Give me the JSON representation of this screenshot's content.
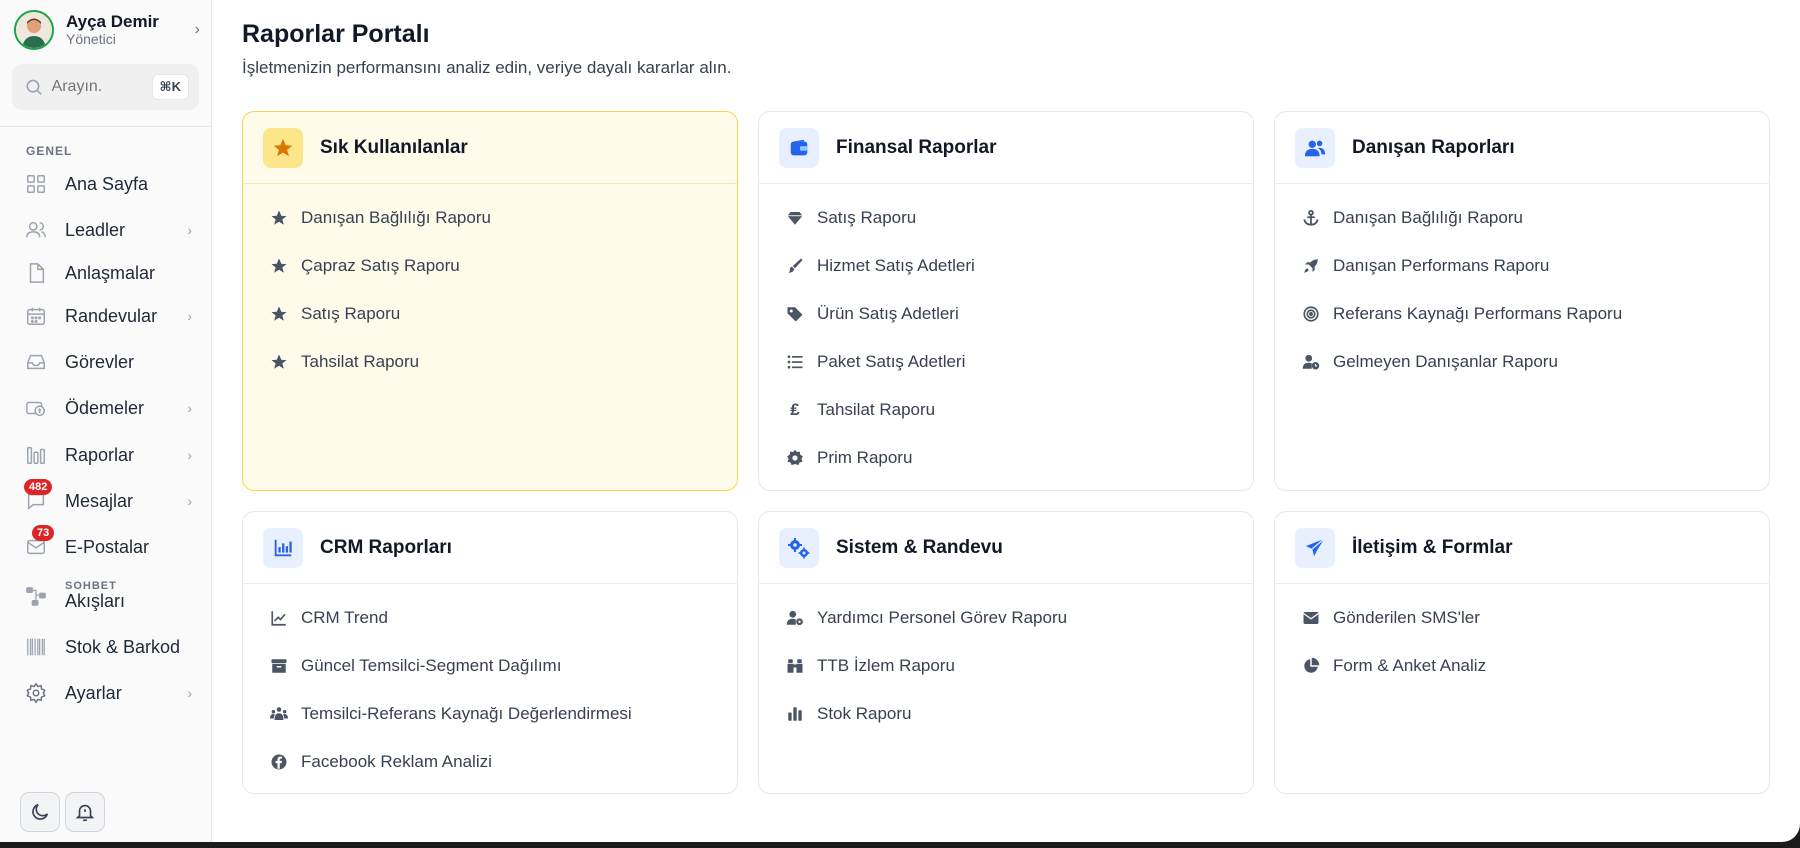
{
  "profile": {
    "name": "Ayça Demir",
    "role": "Yönetici"
  },
  "search": {
    "placeholder": "Arayın.",
    "shortcut": "⌘K"
  },
  "sidebar": {
    "section": "GENEL",
    "items": [
      {
        "label": "Ana Sayfa",
        "icon": "grid-icon"
      },
      {
        "label": "Leadler",
        "icon": "users-icon",
        "chevron": true
      },
      {
        "label": "Anlaşmalar",
        "icon": "document-icon"
      },
      {
        "label": "Randevular",
        "icon": "calendar-icon",
        "chevron": true
      },
      {
        "label": "Görevler",
        "icon": "inbox-icon"
      },
      {
        "label": "Ödemeler",
        "icon": "payments-icon",
        "chevron": true
      },
      {
        "label": "Raporlar",
        "icon": "bars-icon",
        "chevron": true
      },
      {
        "label": "Mesajlar",
        "icon": "chat-icon",
        "chevron": true,
        "badge": "482"
      },
      {
        "label": "E-Postalar",
        "icon": "mail-icon",
        "badge": "73"
      },
      {
        "label": "Akışları",
        "small": "SOHBET",
        "icon": "flow-icon"
      },
      {
        "label": "Stok & Barkod",
        "icon": "barcode-icon"
      },
      {
        "label": "Ayarlar",
        "icon": "gear-icon",
        "chevron": true
      }
    ]
  },
  "page": {
    "title": "Raporlar Portalı",
    "subtitle": "İşletmenizin performansını analiz edin, veriye dayalı kararlar alın."
  },
  "cards": [
    {
      "title": "Sık Kullanılanlar",
      "icon": "star-icon",
      "items": [
        "Danışan Bağlılığı Raporu",
        "Çapraz Satış Raporu",
        "Satış Raporu",
        "Tahsilat Raporu"
      ]
    },
    {
      "title": "Finansal Raporlar",
      "icon": "wallet-icon",
      "items": [
        "Satış Raporu",
        "Hizmet Satış Adetleri",
        "Ürün Satış Adetleri",
        "Paket Satış Adetleri",
        "Tahsilat Raporu",
        "Prim Raporu"
      ]
    },
    {
      "title": "Danışan Raporları",
      "icon": "user-group-icon",
      "items": [
        "Danışan Bağlılığı Raporu",
        "Danışan Performans Raporu",
        "Referans Kaynağı Performans Raporu",
        "Gelmeyen Danışanlar Raporu"
      ]
    },
    {
      "title": "CRM Raporları",
      "icon": "chart-icon",
      "items": [
        "CRM Trend",
        "Güncel Temsilci-Segment Dağılımı",
        "Temsilci-Referans Kaynağı Değerlendirmesi",
        "Facebook Reklam Analizi"
      ]
    },
    {
      "title": "Sistem & Randevu",
      "icon": "gears-icon",
      "items": [
        "Yardımcı Personel Görev Raporu",
        "TTB İzlem Raporu",
        "Stok Raporu"
      ]
    },
    {
      "title": "İletişim & Formlar",
      "icon": "paper-plane-icon",
      "items": [
        "Gönderilen SMS'ler",
        "Form & Anket Analiz"
      ]
    }
  ],
  "colors": {
    "accent": "#2563eb",
    "favorite": "#fffbeb",
    "badge": "#dc2626",
    "avatar_ring": "#16a34a"
  }
}
